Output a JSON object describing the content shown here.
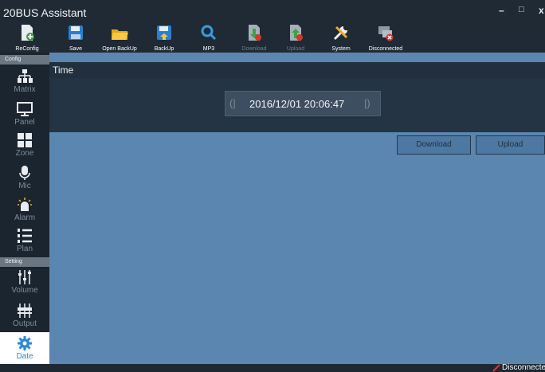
{
  "window": {
    "title": "20BUS Assistant",
    "controls": {
      "minimize": "–",
      "maximize": "□",
      "close": "x"
    }
  },
  "toolbar": {
    "items": [
      {
        "label": "ReConfig",
        "icon": "reconfig-icon",
        "enabled": true
      },
      {
        "label": "Save",
        "icon": "save-icon",
        "enabled": true
      },
      {
        "label": "Open BackUp",
        "icon": "folder-icon",
        "enabled": true
      },
      {
        "label": "BackUp",
        "icon": "backup-icon",
        "enabled": true
      },
      {
        "label": "MP3",
        "icon": "search-icon",
        "enabled": true
      },
      {
        "label": "Download",
        "icon": "download-icon",
        "enabled": false
      },
      {
        "label": "Upload",
        "icon": "upload-icon",
        "enabled": false
      },
      {
        "label": "System",
        "icon": "tools-icon",
        "enabled": true
      },
      {
        "label": "Disconnected",
        "icon": "disconnected-icon",
        "enabled": true
      }
    ]
  },
  "sidebar": {
    "config_header": "Config",
    "setting_header": "Setting",
    "items": [
      {
        "label": "Matrix",
        "icon": "matrix-icon"
      },
      {
        "label": "Panel",
        "icon": "panel-icon"
      },
      {
        "label": "Zone",
        "icon": "zone-icon"
      },
      {
        "label": "Mic",
        "icon": "mic-icon"
      },
      {
        "label": "Alarm",
        "icon": "alarm-icon"
      },
      {
        "label": "Plan",
        "icon": "plan-icon"
      },
      {
        "label": "Volume",
        "icon": "volume-icon"
      },
      {
        "label": "Output",
        "icon": "output-icon"
      },
      {
        "label": "Date",
        "icon": "gear-icon",
        "active": true
      }
    ]
  },
  "panel": {
    "title": "Time",
    "time_value": "2016/12/01 20:06:47",
    "left_bracket": "(|",
    "right_bracket": "|)"
  },
  "actions": {
    "download": "Download",
    "upload": "Upload"
  },
  "status": {
    "text": "Disconnected"
  },
  "colors": {
    "accent": "#2c89d6",
    "main_bg": "#5a86b0",
    "chrome": "#1f2a35"
  }
}
